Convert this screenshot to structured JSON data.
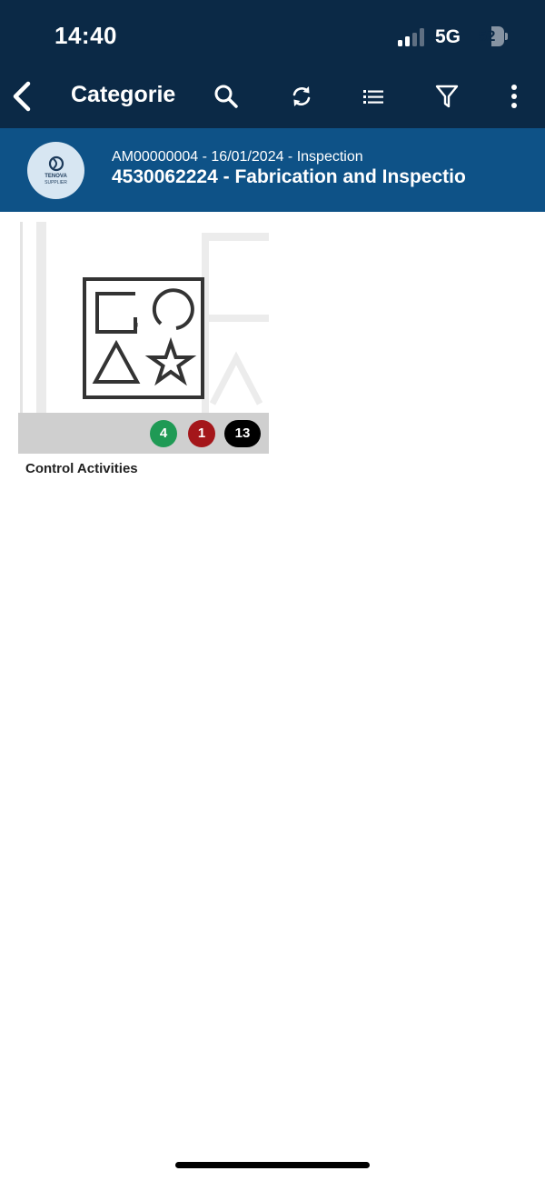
{
  "status_bar": {
    "time": "14:40",
    "network": "5G",
    "battery": "52"
  },
  "nav": {
    "title": "Categorie",
    "icons": [
      "back-icon",
      "search-icon",
      "sync-icon",
      "list-icon",
      "filter-icon",
      "more-icon"
    ]
  },
  "header": {
    "avatar_line1": "TENOVA",
    "avatar_line2": "SUPPLIER",
    "subtitle": "AM00000004 - 16/01/2024 - Inspection",
    "title": "4530062224 - Fabrication and Inspectio"
  },
  "categories": [
    {
      "label": "Control Activities",
      "icon": "shapes-icon",
      "badges": [
        {
          "value": "4",
          "color": "#1f9a55"
        },
        {
          "value": "1",
          "color": "#a4161a"
        },
        {
          "value": "13",
          "color": "#000000"
        }
      ]
    }
  ],
  "colors": {
    "topbar": "#0b2946",
    "header_band": "#0e5287",
    "card_bar": "#cfcfcf"
  }
}
